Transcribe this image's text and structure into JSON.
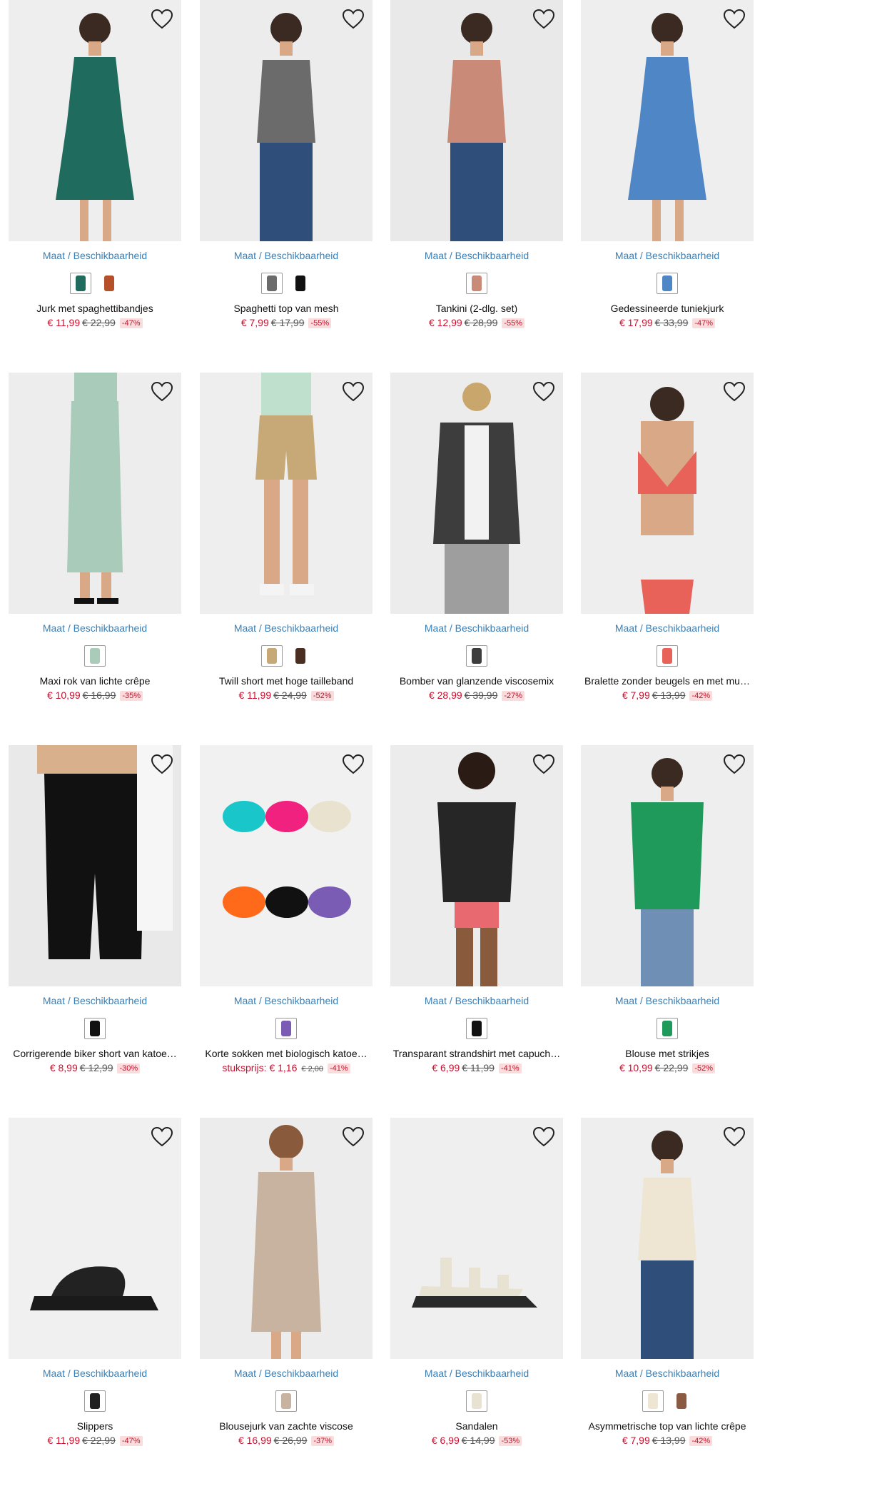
{
  "availability_label": "Maat / Beschikbaarheid",
  "products": [
    {
      "name": "Jurk met spaghettibandjes",
      "price": "€ 11,99",
      "old_price": "€ 22,99",
      "discount": "-47%",
      "image": "green-spaghetti-dress",
      "bg": "#eeeeee",
      "swatches": [
        "#1f6b5e",
        "#b5502a"
      ]
    },
    {
      "name": "Spaghetti top van mesh",
      "price": "€ 7,99",
      "old_price": "€ 17,99",
      "discount": "-55%",
      "image": "leopard-mesh-top",
      "bg": "#ececec",
      "swatches": [
        "#6b6b6b",
        "#111111"
      ]
    },
    {
      "name": "Tankini (2-dlg. set)",
      "price": "€ 12,99",
      "old_price": "€ 28,99",
      "discount": "-55%",
      "image": "patterned-tankini",
      "bg": "#e9e9e9",
      "swatches": [
        "#c98a78"
      ]
    },
    {
      "name": "Gedessineerde tuniekjurk",
      "price": "€ 17,99",
      "old_price": "€ 33,99",
      "discount": "-47%",
      "image": "blue-tunic-dress",
      "bg": "#eeeeee",
      "swatches": [
        "#4f86c6"
      ]
    },
    {
      "name": "Maxi rok van lichte crêpe",
      "price": "€ 10,99",
      "old_price": "€ 16,99",
      "discount": "-35%",
      "image": "mint-maxi-skirt",
      "bg": "#ededed",
      "swatches": [
        "#a9cbb9"
      ]
    },
    {
      "name": "Twill short met hoge tailleband",
      "price": "€ 11,99",
      "old_price": "€ 24,99",
      "discount": "-52%",
      "image": "beige-twill-shorts",
      "bg": "#eeeeee",
      "swatches": [
        "#c7a877",
        "#4a2e22"
      ]
    },
    {
      "name": "Bomber van glanzende viscosemix",
      "price": "€ 28,99",
      "old_price": "€ 39,99",
      "discount": "-27%",
      "image": "grey-bomber-jacket",
      "bg": "#ececec",
      "swatches": [
        "#3d3d3d"
      ]
    },
    {
      "name": "Bralette zonder beugels en met mu…",
      "price": "€ 7,99",
      "old_price": "€ 13,99",
      "discount": "-42%",
      "image": "coral-lace-bralette",
      "bg": "#eeeeee",
      "swatches": [
        "#e8625a"
      ]
    },
    {
      "name": "Corrigerende biker short van katoe…",
      "price": "€ 8,99",
      "old_price": "€ 12,99",
      "discount": "-30%",
      "image": "black-biker-shorts",
      "bg": "#e9e9e9",
      "swatches": [
        "#111111"
      ]
    },
    {
      "name": "Korte sokken met biologisch katoe…",
      "unit_label": "stuksprijs: € 1,16",
      "old_price": "€ 2,00",
      "discount": "-41%",
      "image": "sneaker-socks-set",
      "bg": "#f1f1f1",
      "swatches": [
        "#7b5cb5"
      ]
    },
    {
      "name": "Transparant strandshirt met capuch…",
      "price": "€ 6,99",
      "old_price": "€ 11,99",
      "discount": "-41%",
      "image": "sheer-beach-shirt",
      "bg": "#ececec",
      "swatches": [
        "#111111"
      ]
    },
    {
      "name": "Blouse met strikjes",
      "price": "€ 10,99",
      "old_price": "€ 22,99",
      "discount": "-52%",
      "image": "green-tie-blouse",
      "bg": "#eeeeee",
      "swatches": [
        "#1f9a5a"
      ]
    },
    {
      "name": "Slippers",
      "price": "€ 11,99",
      "old_price": "€ 22,99",
      "discount": "-47%",
      "image": "black-slippers",
      "bg": "#f0f0f0",
      "swatches": [
        "#222222"
      ]
    },
    {
      "name": "Blousejurk van zachte viscose",
      "price": "€ 16,99",
      "old_price": "€ 26,99",
      "discount": "-37%",
      "image": "taupe-shirt-dress",
      "bg": "#ececec",
      "swatches": [
        "#c8b3a0"
      ]
    },
    {
      "name": "Sandalen",
      "price": "€ 6,99",
      "old_price": "€ 14,99",
      "discount": "-53%",
      "image": "white-sandals",
      "bg": "#efefef",
      "swatches": [
        "#e8e2d2"
      ]
    },
    {
      "name": "Asymmetrische top van lichte crêpe",
      "price": "€ 7,99",
      "old_price": "€ 13,99",
      "discount": "-42%",
      "image": "cream-asymmetric-top",
      "bg": "#eeeeee",
      "swatches": [
        "#eee5d2",
        "#8b5a43"
      ]
    }
  ]
}
